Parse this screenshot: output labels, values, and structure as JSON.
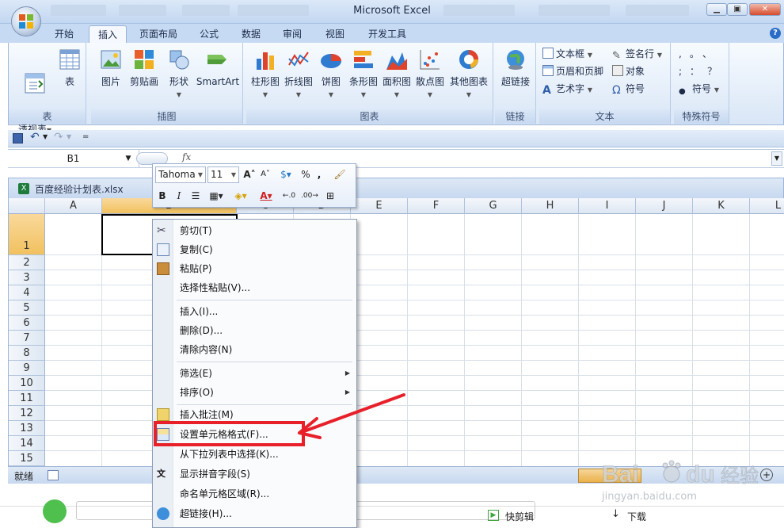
{
  "window": {
    "title": "Microsoft Excel"
  },
  "tabs": [
    "开始",
    "插入",
    "页面布局",
    "公式",
    "数据",
    "审阅",
    "视图",
    "开发工具"
  ],
  "active_tab": "插入",
  "ribbon": {
    "table_group": {
      "label": "表",
      "pivot_label": "数据\n透视表",
      "table_label": "表"
    },
    "illus_group": {
      "label": "插图",
      "picture": "图片",
      "clipart": "剪贴画",
      "shapes": "形状",
      "smartart": "SmartArt"
    },
    "chart_group": {
      "label": "图表",
      "column": "柱形图",
      "line": "折线图",
      "pie": "饼图",
      "bar": "条形图",
      "area": "面积图",
      "scatter": "散点图",
      "other": "其他图表"
    },
    "link_group": {
      "label": "链接",
      "hyperlink": "超链接"
    },
    "text_group": {
      "label": "文本",
      "textbox": "文本框",
      "header_footer": "页眉和页脚",
      "wordart": "艺术字",
      "signature": "签名行",
      "object": "对象",
      "symbol": "符号"
    },
    "special_group": {
      "label": "特殊符号",
      "symbol": "符号",
      "punct": [
        ",",
        "。",
        "、",
        ";",
        "：",
        "？"
      ]
    }
  },
  "namebox": "B1",
  "workbook_title": "百度经验计划表.xlsx",
  "columns": [
    "A",
    "B",
    "C",
    "D",
    "E",
    "F",
    "G",
    "H",
    "I",
    "J",
    "K",
    "L"
  ],
  "rows": [
    "1",
    "2",
    "3",
    "4",
    "5",
    "6",
    "7",
    "8",
    "9",
    "10",
    "11",
    "12",
    "13",
    "14",
    "15"
  ],
  "mini_toolbar": {
    "font": "Tahoma",
    "size": "11"
  },
  "context_menu": {
    "cut": "剪切(T)",
    "copy": "复制(C)",
    "paste": "粘贴(P)",
    "paste_special": "选择性粘贴(V)...",
    "insert": "插入(I)...",
    "delete": "删除(D)...",
    "clear": "清除内容(N)",
    "filter": "筛选(E)",
    "sort": "排序(O)",
    "comment": "插入批注(M)",
    "format_cells": "设置单元格格式(F)...",
    "pick_list": "从下拉列表中选择(K)...",
    "phonetic": "显示拼音字段(S)",
    "define_name": "命名单元格区域(R)...",
    "hyperlink": "超链接(H)..."
  },
  "status": {
    "ready": "就绪"
  },
  "taskbar": {
    "clip": "快剪辑",
    "download": "下载"
  },
  "watermark": {
    "brand": "Bai du 经验",
    "url": "jingyan.baidu.com"
  },
  "colors": {
    "highlight": "#e8202a",
    "ribbon": "#d9e6f6"
  }
}
